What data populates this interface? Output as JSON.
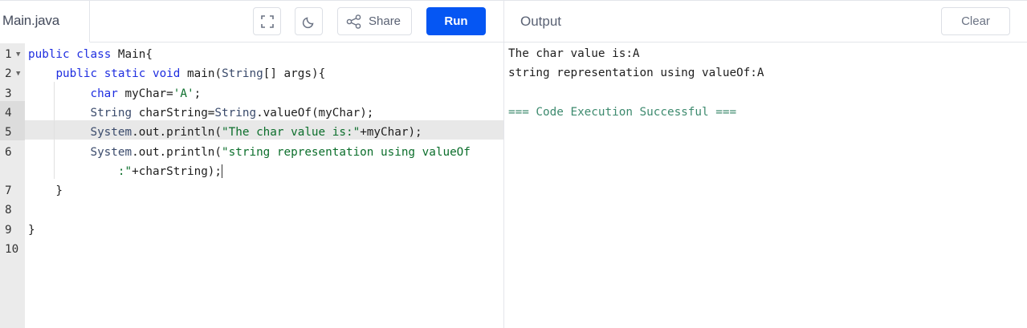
{
  "editor": {
    "file_tab": "Main.java",
    "toolbar": {
      "fullscreen_icon": "fullscreen-icon",
      "theme_icon": "moon-icon",
      "share_label": "Share",
      "share_icon": "share-icon",
      "run_label": "Run",
      "run_color": "#0556f3"
    },
    "line_numbers": [
      "1",
      "2",
      "3",
      "4",
      "5",
      "6",
      "",
      "7",
      "8",
      "9",
      "10"
    ],
    "active_line": "6"
  },
  "output": {
    "title": "Output",
    "clear_label": "Clear",
    "lines": [
      "The char value is:A",
      "string representation using valueOf:A",
      "",
      "=== Code Execution Successful ==="
    ],
    "success_color": "#3d8a6e"
  }
}
